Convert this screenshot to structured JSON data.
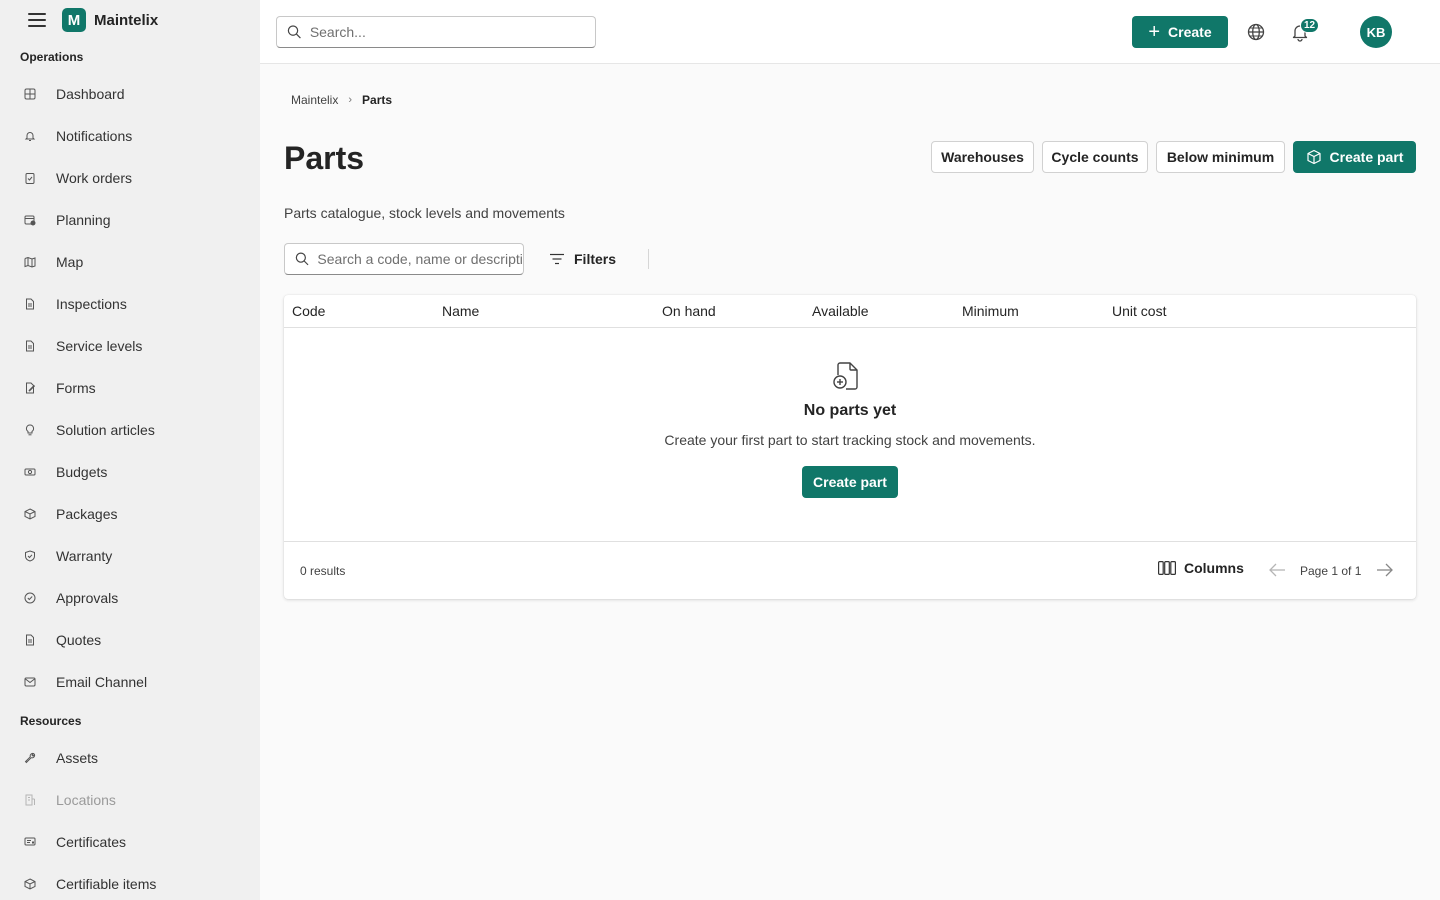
{
  "app": {
    "name": "Maintelix"
  },
  "sidebar": {
    "sections": [
      {
        "title": "Operations"
      },
      {
        "title": "Resources"
      }
    ],
    "operations": [
      {
        "label": "Dashboard",
        "icon": "dashboard-icon"
      },
      {
        "label": "Notifications",
        "icon": "bell-icon"
      },
      {
        "label": "Work orders",
        "icon": "clipboard-icon"
      },
      {
        "label": "Planning",
        "icon": "calendar-icon"
      },
      {
        "label": "Map",
        "icon": "map-icon"
      },
      {
        "label": "Inspections",
        "icon": "document-icon"
      },
      {
        "label": "Service levels",
        "icon": "document-icon"
      },
      {
        "label": "Forms",
        "icon": "form-edit-icon"
      },
      {
        "label": "Solution articles",
        "icon": "lightbulb-icon"
      },
      {
        "label": "Budgets",
        "icon": "money-icon"
      },
      {
        "label": "Packages",
        "icon": "package-icon"
      },
      {
        "label": "Warranty",
        "icon": "shield-icon"
      },
      {
        "label": "Approvals",
        "icon": "check-circle-icon"
      },
      {
        "label": "Quotes",
        "icon": "document-icon"
      },
      {
        "label": "Email Channel",
        "icon": "mail-icon"
      }
    ],
    "resources": [
      {
        "label": "Assets",
        "icon": "wrench-icon"
      },
      {
        "label": "Locations",
        "icon": "building-icon",
        "disabled": true
      },
      {
        "label": "Certificates",
        "icon": "certificate-icon"
      },
      {
        "label": "Certifiable items",
        "icon": "package-icon"
      }
    ]
  },
  "topbar": {
    "search_placeholder": "Search...",
    "create_label": "Create",
    "notification_count": "12",
    "avatar_initials": "KB"
  },
  "breadcrumb": [
    "Maintelix",
    "Parts"
  ],
  "page": {
    "title": "Parts",
    "subtitle": "Parts catalogue, stock levels and movements",
    "actions": [
      "Warehouses",
      "Cycle counts",
      "Below minimum"
    ],
    "create_label": "Create part"
  },
  "toolbar": {
    "search_placeholder": "Search a code, name or description",
    "filters_label": "Filters"
  },
  "table": {
    "columns": [
      "Code",
      "Name",
      "On hand",
      "Available",
      "Minimum",
      "Unit cost"
    ],
    "empty": {
      "title": "No parts yet",
      "text": "Create your first part to start tracking stock and movements.",
      "button": "Create part"
    },
    "footer": {
      "results": "0 results",
      "columns_label": "Columns",
      "page_text": "Page 1 of 1"
    }
  },
  "colors": {
    "brand": "#107769",
    "sidebar_bg": "#f0f0f0"
  }
}
